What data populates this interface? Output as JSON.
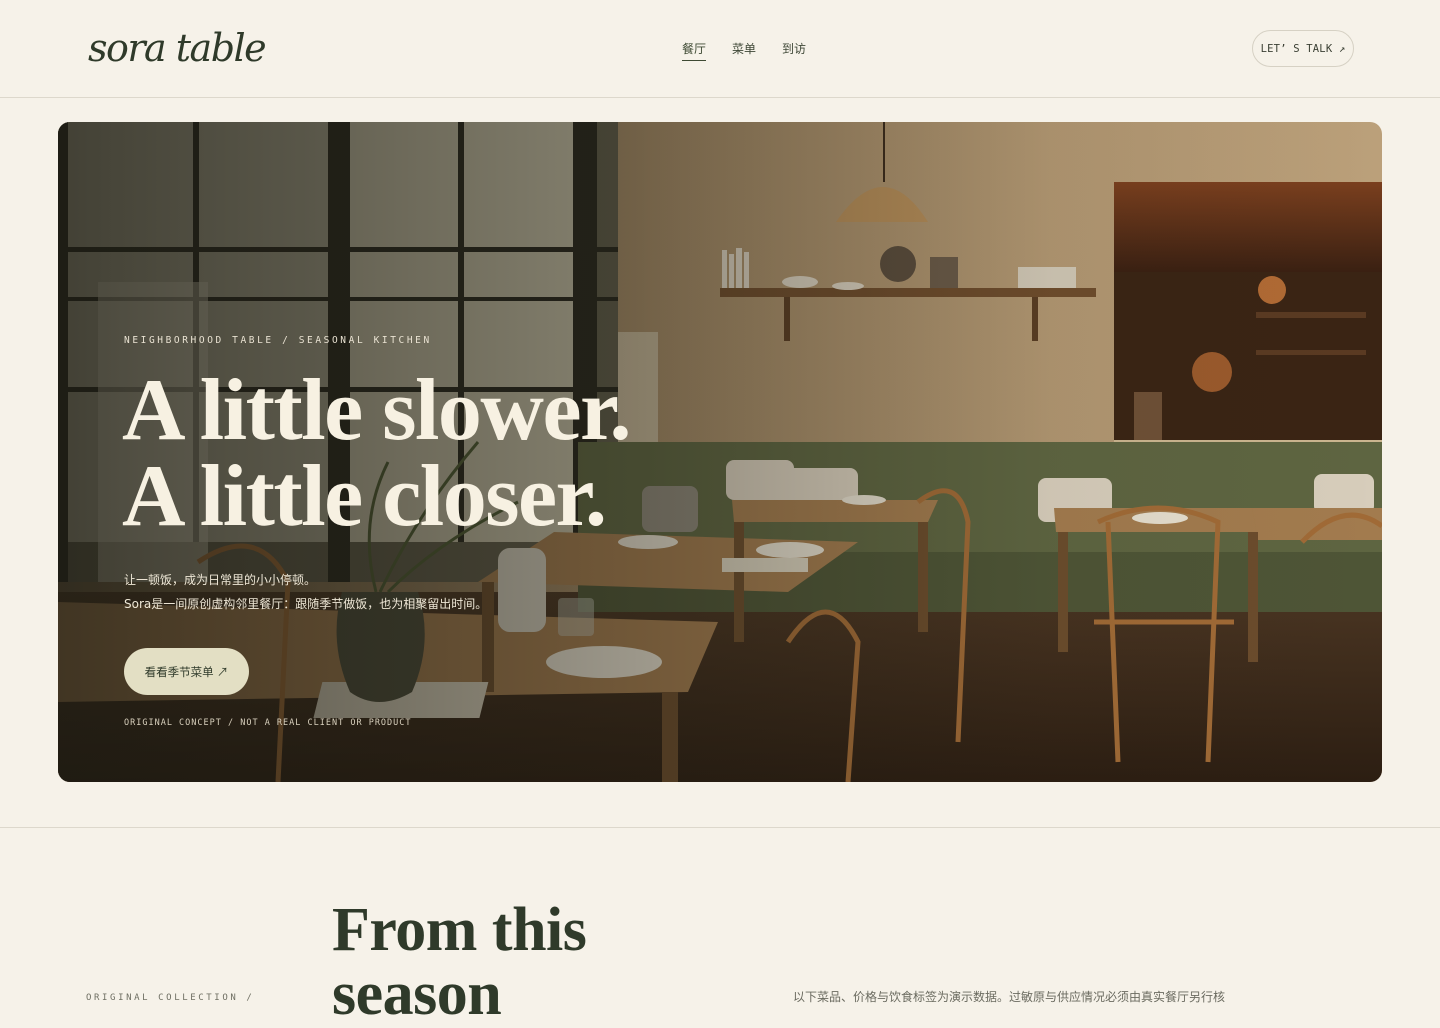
{
  "header": {
    "logo": "sora table",
    "nav": [
      {
        "label": "餐厅",
        "active": true
      },
      {
        "label": "菜单",
        "active": false
      },
      {
        "label": "到访",
        "active": false
      }
    ],
    "cta": "LET’ S TALK ↗"
  },
  "hero": {
    "eyebrow": "NEIGHBORHOOD TABLE / SEASONAL KITCHEN",
    "title_line1": "A little slower.",
    "title_line2": "A little closer.",
    "desc_line1": "让一顿饭，成为日常里的小小停顿。",
    "desc_line2": "Sora是一间原创虚构邻里餐厅：跟随季节做饭，也为相聚留出时间。",
    "cta": "看看季节菜单 ↗",
    "note": "ORIGINAL CONCEPT / NOT A REAL CLIENT OR PRODUCT"
  },
  "season": {
    "title_line1": "From this",
    "title_line2": "season",
    "eyebrow": "ORIGINAL COLLECTION /",
    "note": "以下菜品、价格与饮食标签为演示数据。过敏原与供应情况必须由真实餐厅另行核"
  },
  "colors": {
    "background": "#f6f2e9",
    "ink": "#2f3a2a",
    "cta_fill": "#e3dfc4",
    "sofa_green": "#5e6541"
  }
}
